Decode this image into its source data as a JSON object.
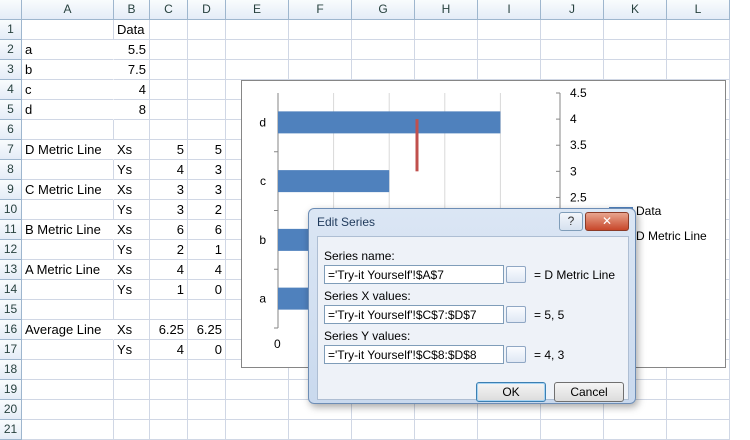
{
  "sheet": {
    "col_headers": [
      "A",
      "B",
      "C",
      "D",
      "E",
      "F",
      "G",
      "H",
      "I",
      "J",
      "K",
      "L"
    ],
    "row_headers": [
      "1",
      "2",
      "3",
      "4",
      "5",
      "6",
      "7",
      "8",
      "9",
      "10",
      "11",
      "12",
      "13",
      "14",
      "15",
      "16",
      "17",
      "18",
      "19",
      "20",
      "21"
    ],
    "cells": {
      "B1": "Data",
      "A2": "a",
      "B2": "5.5",
      "A3": "b",
      "B3": "7.5",
      "A4": "c",
      "B4": "4",
      "A5": "d",
      "B5": "8",
      "A7": "D Metric Line",
      "B7": "Xs",
      "C7": "5",
      "D7": "5",
      "B8": "Ys",
      "C8": "4",
      "D8": "3",
      "A9": "C Metric Line",
      "B9": "Xs",
      "C9": "3",
      "D9": "3",
      "B10": "Ys",
      "C10": "3",
      "D10": "2",
      "A11": "B Metric Line",
      "B11": "Xs",
      "C11": "6",
      "D11": "6",
      "B12": "Ys",
      "C12": "2",
      "D12": "1",
      "A13": "A Metric Line",
      "B13": "Xs",
      "C13": "4",
      "D13": "4",
      "B14": "Ys",
      "C14": "1",
      "D14": "0",
      "A16": "Average Line",
      "B16": "Xs",
      "C16": "6.25",
      "D16": "6.25",
      "B17": "Ys",
      "C17": "4",
      "D17": "0"
    }
  },
  "chart_data": {
    "type": "bar",
    "orientation": "horizontal",
    "categories": [
      "a",
      "b",
      "c",
      "d"
    ],
    "values": [
      5.5,
      7.5,
      4,
      8
    ],
    "xlim": [
      0,
      10
    ],
    "x_tick_labels": [
      "0"
    ],
    "secondary_y_ticks": [
      "2.5",
      "3",
      "3.5",
      "4",
      "4.5"
    ],
    "secondary_ylim": [
      0,
      4.5
    ],
    "metric_line": {
      "x": 5,
      "y": [
        4,
        3
      ]
    },
    "legend": [
      "Data",
      "D Metric Line"
    ],
    "bar_color": "#4f81bd",
    "line_color": "#c0504d"
  },
  "dialog": {
    "title": "Edit Series",
    "help_label": "?",
    "close_label": "✕",
    "name_label": "Series name:",
    "name_value": "='Try-it Yourself'!$A$7",
    "name_result": "= D Metric Line",
    "x_label": "Series X values:",
    "x_value": "='Try-it Yourself'!$C$7:$D$7",
    "x_result": "= 5, 5",
    "y_label": "Series Y values:",
    "y_value": "='Try-it Yourself'!$C$8:$D$8",
    "y_result": "= 4, 3",
    "ok_label": "OK",
    "cancel_label": "Cancel"
  }
}
